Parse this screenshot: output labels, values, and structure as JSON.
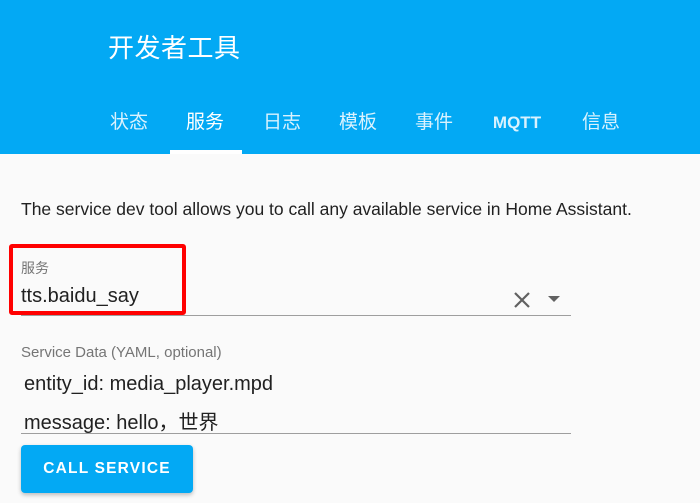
{
  "header": {
    "title": "开发者工具",
    "background_color": "#03a9f4"
  },
  "tabs": [
    {
      "label": "状态",
      "active": false
    },
    {
      "label": "服务",
      "active": true
    },
    {
      "label": "日志",
      "active": false
    },
    {
      "label": "模板",
      "active": false
    },
    {
      "label": "事件",
      "active": false
    },
    {
      "label": "MQTT",
      "active": false
    },
    {
      "label": "信息",
      "active": false
    }
  ],
  "main": {
    "description": "The service dev tool allows you to call any available service in Home Assistant.",
    "service_field": {
      "label": "服务",
      "value": "tts.baidu_say",
      "clear_icon": "close-icon",
      "dropdown_icon": "dropdown-arrow-icon"
    },
    "service_data": {
      "label": "Service Data (YAML, optional)",
      "lines": [
        "entity_id: media_player.mpd",
        "message: hello，世界"
      ]
    },
    "call_button": {
      "label": "CALL SERVICE"
    }
  },
  "annotation": {
    "highlight_color": "#ff0000"
  }
}
